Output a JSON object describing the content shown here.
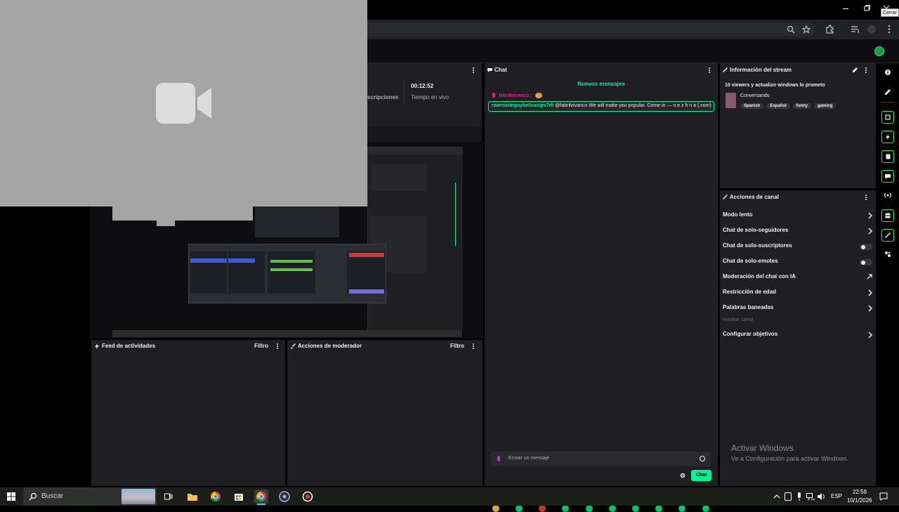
{
  "browser": {
    "close_tooltip": "Cerrar"
  },
  "video_overlay": {
    "icon": "video-camera-icon"
  },
  "stats": {
    "subscriptions_label": "scripciones",
    "time_value": "00:12:52",
    "time_label": "Tiempo en vivo"
  },
  "chat": {
    "title": "Chat",
    "new_messages": "Nuevos mensajes",
    "messages": [
      {
        "user": "fabrilvivanco",
        "text": ":",
        "color": "#e91e8c"
      },
      {
        "user": "rawroaringaybe0sxcipv7dt",
        "text": "@fabrilvivanco We will make you popular. Come in — n e z h n a (.com)",
        "color": "#00f593"
      }
    ],
    "input_placeholder": "Enviar un mensaje",
    "send_label": "Chat"
  },
  "stream_info": {
    "title": "Información del stream",
    "stream_title": "10 viewers y actualizo windows lo prometo",
    "category": "Conversando",
    "tags": [
      "Spanish",
      "Español",
      "funny",
      "gaming"
    ]
  },
  "channel_actions": {
    "title": "Acciones de canal",
    "items": [
      {
        "label": "Modo lento",
        "control": "chevron"
      },
      {
        "label": "Chat de solo-seguidores",
        "control": "chevron"
      },
      {
        "label": "Chat de solo-suscriptores",
        "control": "toggle"
      },
      {
        "label": "Chat de solo-emotes",
        "control": "toggle"
      },
      {
        "label": "Moderación del chat con IA",
        "control": "external"
      },
      {
        "label": "Restricción de edad",
        "control": "chevron"
      },
      {
        "label": "Palabras baneadas",
        "control": "chevron"
      },
      {
        "label": "Hostear canal",
        "control": "disabled"
      },
      {
        "label": "Configurar objetivos",
        "control": "chevron"
      }
    ]
  },
  "activity_feed": {
    "title": "Feed de actividades",
    "filter": "Filtro"
  },
  "mod_actions": {
    "title": "Acciones de moderador",
    "filter": "Filtro"
  },
  "watermark": {
    "line1": "Activar Windows",
    "line2": "Ve a Configuración para activar Windows."
  },
  "taskbar": {
    "search_placeholder": "Buscar",
    "language": "ESP",
    "time": "22:58",
    "date": "10/1/2026"
  },
  "colors": {
    "accent": "#00f593",
    "panel": "#1f1f23",
    "background": "#0e0e10"
  }
}
